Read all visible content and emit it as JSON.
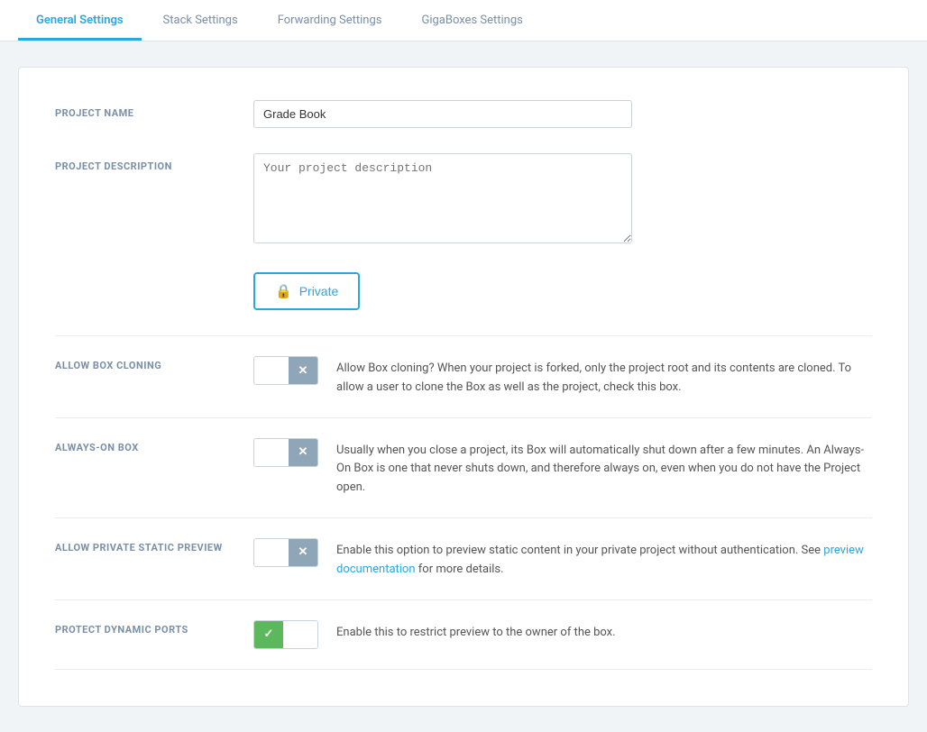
{
  "tabs": [
    {
      "id": "general",
      "label": "General Settings",
      "active": true
    },
    {
      "id": "stack",
      "label": "Stack Settings",
      "active": false
    },
    {
      "id": "forwarding",
      "label": "Forwarding Settings",
      "active": false
    },
    {
      "id": "gigaboxes",
      "label": "GigaBoxes Settings",
      "active": false
    }
  ],
  "form": {
    "project_name_label": "PROJECT NAME",
    "project_name_value": "Grade Book",
    "project_desc_label": "PROJECT DESCRIPTION",
    "project_desc_placeholder": "Your project description",
    "private_button_label": "Private"
  },
  "toggles": [
    {
      "id": "allow-box-cloning",
      "label": "ALLOW BOX CLONING",
      "state": "off",
      "description": "Allow Box cloning? When your project is forked, only the project root and its contents are cloned. To allow a user to clone the Box as well as the project, check this box."
    },
    {
      "id": "always-on-box",
      "label": "ALWAYS-ON BOX",
      "state": "off",
      "description": "Usually when you close a project, its Box will automatically shut down after a few minutes. An Always-On Box is one that never shuts down, and therefore always on, even when you do not have the Project open."
    },
    {
      "id": "allow-private-static-preview",
      "label": "ALLOW PRIVATE STATIC PREVIEW",
      "state": "off",
      "description_before_link": "Enable this option to preview static content in your private project without authentication. See ",
      "link_text": "preview documentation",
      "link_href": "#",
      "description_after_link": " for more details."
    },
    {
      "id": "protect-dynamic-ports",
      "label": "PROTECT DYNAMIC PORTS",
      "state": "on",
      "description": "Enable this to restrict preview to the owner of the box."
    }
  ],
  "icons": {
    "lock": "🔒",
    "check": "✓",
    "times": "✕"
  }
}
